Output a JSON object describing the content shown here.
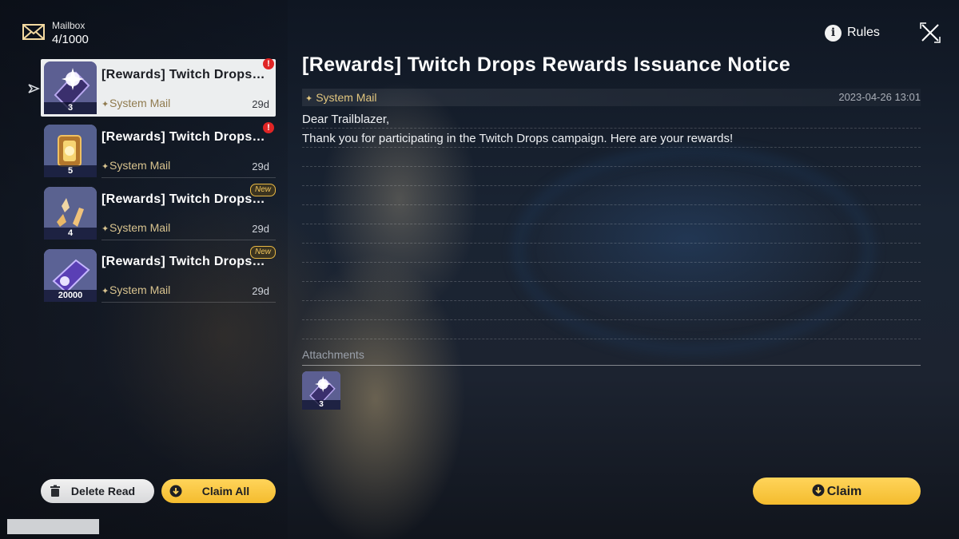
{
  "header": {
    "title": "Mailbox",
    "count": "4/1000",
    "rules_label": "Rules"
  },
  "mails": [
    {
      "subject": "[Rewards] Twitch Drops…",
      "sender": "System Mail",
      "age": "29d",
      "qty": "3",
      "badge": "alert",
      "selected": true,
      "icon": "relic-card-icon"
    },
    {
      "subject": "[Rewards] Twitch Drops…",
      "sender": "System Mail",
      "age": "29d",
      "qty": "5",
      "badge": "alert",
      "selected": false,
      "icon": "lantern-item-icon"
    },
    {
      "subject": "[Rewards] Twitch Drops…",
      "sender": "System Mail",
      "age": "29d",
      "qty": "4",
      "badge": "New",
      "selected": false,
      "icon": "crystal-shards-icon"
    },
    {
      "subject": "[Rewards] Twitch Drops…",
      "sender": "System Mail",
      "age": "29d",
      "qty": "20000",
      "badge": "New",
      "selected": false,
      "icon": "credit-card-icon"
    }
  ],
  "detail": {
    "title": "[Rewards] Twitch Drops Rewards Issuance Notice",
    "sender": "System Mail",
    "date": "2023-04-26 13:01",
    "body": [
      "Dear Trailblazer,",
      "Thank you for participating in the Twitch Drops campaign. Here are your rewards!"
    ],
    "attachments_label": "Attachments",
    "attachments": [
      {
        "qty": "3",
        "icon": "relic-card-icon"
      }
    ]
  },
  "buttons": {
    "delete_read": "Delete Read",
    "claim_all": "Claim All",
    "claim": "Claim"
  },
  "colors": {
    "accent_yellow": "#f4bc2e",
    "alert_red": "#e02525",
    "sender_gold": "#d8c38f"
  }
}
